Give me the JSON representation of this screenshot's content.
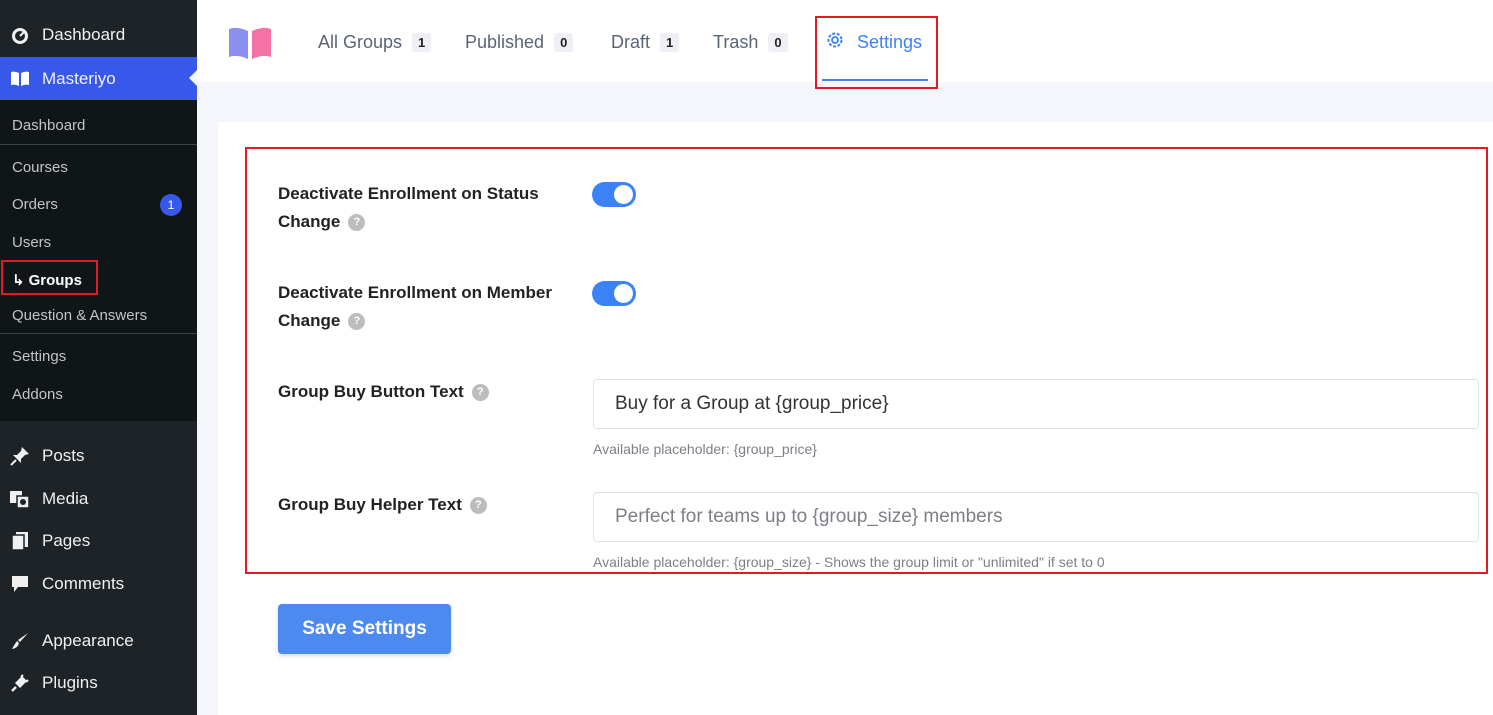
{
  "sidebar": {
    "dashboard": "Dashboard",
    "masteriyo": "Masteriyo",
    "submenu": {
      "dashboard": "Dashboard",
      "courses": "Courses",
      "orders": "Orders",
      "orders_badge": "1",
      "users": "Users",
      "groups": "Groups",
      "qa": "Question & Answers",
      "settings": "Settings",
      "addons": "Addons"
    },
    "posts": "Posts",
    "media": "Media",
    "pages": "Pages",
    "comments": "Comments",
    "appearance": "Appearance",
    "plugins": "Plugins"
  },
  "tabs": [
    {
      "label": "All Groups",
      "count": "1"
    },
    {
      "label": "Published",
      "count": "0"
    },
    {
      "label": "Draft",
      "count": "1"
    },
    {
      "label": "Trash",
      "count": "0"
    },
    {
      "label": "Settings"
    }
  ],
  "form": {
    "deactivate_status_line1": "Deactivate Enrollment on Status",
    "deactivate_status_line2": "Change",
    "deactivate_status_on": true,
    "deactivate_member_line1": "Deactivate Enrollment on Member",
    "deactivate_member_line2": "Change",
    "deactivate_member_on": true,
    "buy_button_label": "Group Buy Button Text",
    "buy_button_value": "Buy for a Group at {group_price}",
    "buy_button_hint": "Available placeholder: {group_price}",
    "helper_label": "Group Buy Helper Text",
    "helper_placeholder": "Perfect for teams up to {group_size} members",
    "helper_hint": "Available placeholder: {group_size} - Shows the group limit or \"unlimited\" if set to 0",
    "help_glyph": "?",
    "save_label": "Save Settings"
  },
  "colors": {
    "accent": "#3b82f6",
    "sidebar_bg": "#1d2327",
    "highlight_border": "#e01b24"
  }
}
